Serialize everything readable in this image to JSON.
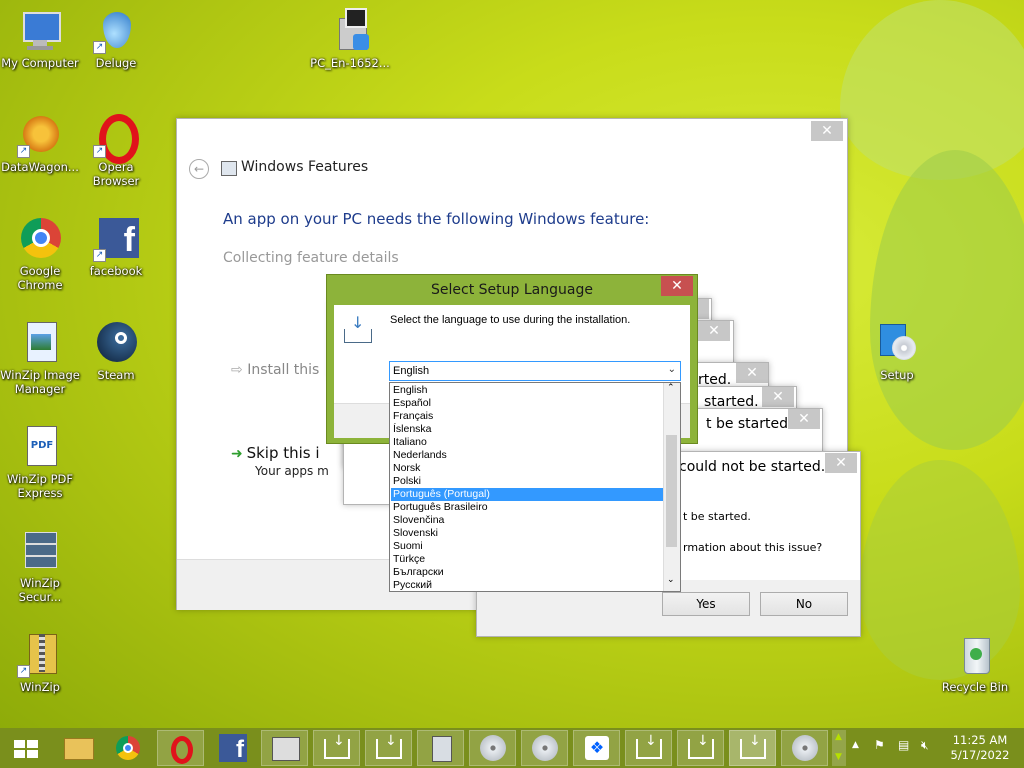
{
  "desktop": {
    "icons": [
      {
        "label": "My Computer"
      },
      {
        "label": "Deluge"
      },
      {
        "label": "PC_En-1652..."
      },
      {
        "label": "DataWagon..."
      },
      {
        "label": "Opera Browser"
      },
      {
        "label": "Google Chrome"
      },
      {
        "label": "facebook"
      },
      {
        "label": "WinZip Image Manager"
      },
      {
        "label": "Steam"
      },
      {
        "label": "Setup"
      },
      {
        "label": "WinZip PDF Express"
      },
      {
        "label": "WinZip Secur..."
      },
      {
        "label": "WinZip"
      },
      {
        "label": "Recycle Bin"
      }
    ]
  },
  "features_window": {
    "title": "Windows Features",
    "heading": "An app on your PC needs the following Windows feature:",
    "status": "Collecting feature details",
    "install_label": "Install this",
    "skip_label": "Skip this i",
    "skip_sub": "Your apps m"
  },
  "error_stack": {
    "msg1": "rted.",
    "msg2": "started.",
    "msg3": "t be started.",
    "msg4": "could not be started.",
    "msg5": "t be started.",
    "msg6": "rmation about this issue?",
    "yes_label": "Yes",
    "no_label": "No"
  },
  "setup_dialog": {
    "title": "Select Setup Language",
    "instruction": "Select the language to use during the installation.",
    "selected_value": "English",
    "options": [
      "English",
      "Español",
      "Français",
      "Íslenska",
      "Italiano",
      "Nederlands",
      "Norsk",
      "Polski",
      "Português (Portugal)",
      "Português Brasileiro",
      "Slovenčina",
      "Slovenski",
      "Suomi",
      "Türkçe",
      "Български",
      "Русский"
    ],
    "highlighted_option": "Português (Portugal)"
  },
  "taskbar": {
    "time": "11:25 AM",
    "date": "5/17/2022"
  },
  "colors": {
    "dialog_accent": "#8db33a",
    "selection": "#3399ff",
    "close_red": "#c75050"
  }
}
